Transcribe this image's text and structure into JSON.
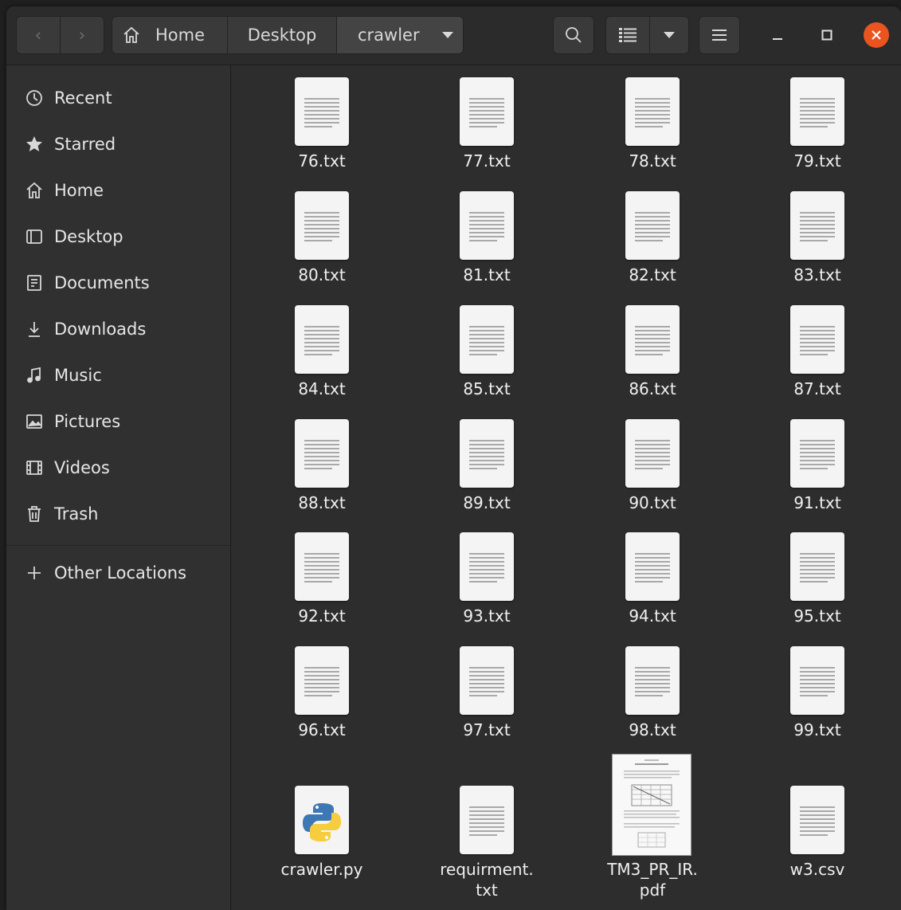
{
  "breadcrumb": {
    "items": [
      {
        "label": "Home"
      },
      {
        "label": "Desktop"
      },
      {
        "label": "crawler"
      }
    ]
  },
  "sidebar": {
    "items": [
      {
        "label": "Recent",
        "icon": "clock-icon"
      },
      {
        "label": "Starred",
        "icon": "star-icon"
      },
      {
        "label": "Home",
        "icon": "home-icon"
      },
      {
        "label": "Desktop",
        "icon": "desktop-icon"
      },
      {
        "label": "Documents",
        "icon": "document-icon"
      },
      {
        "label": "Downloads",
        "icon": "download-icon"
      },
      {
        "label": "Music",
        "icon": "music-icon"
      },
      {
        "label": "Pictures",
        "icon": "picture-icon"
      },
      {
        "label": "Videos",
        "icon": "film-icon"
      },
      {
        "label": "Trash",
        "icon": "trash-icon"
      }
    ],
    "other_locations": {
      "label": "Other Locations",
      "icon": "plus-icon"
    }
  },
  "files": [
    {
      "name": "76.txt",
      "type": "text"
    },
    {
      "name": "77.txt",
      "type": "text"
    },
    {
      "name": "78.txt",
      "type": "text"
    },
    {
      "name": "79.txt",
      "type": "text"
    },
    {
      "name": "80.txt",
      "type": "text"
    },
    {
      "name": "81.txt",
      "type": "text"
    },
    {
      "name": "82.txt",
      "type": "text"
    },
    {
      "name": "83.txt",
      "type": "text"
    },
    {
      "name": "84.txt",
      "type": "text"
    },
    {
      "name": "85.txt",
      "type": "text"
    },
    {
      "name": "86.txt",
      "type": "text"
    },
    {
      "name": "87.txt",
      "type": "text"
    },
    {
      "name": "88.txt",
      "type": "text"
    },
    {
      "name": "89.txt",
      "type": "text"
    },
    {
      "name": "90.txt",
      "type": "text"
    },
    {
      "name": "91.txt",
      "type": "text"
    },
    {
      "name": "92.txt",
      "type": "text"
    },
    {
      "name": "93.txt",
      "type": "text"
    },
    {
      "name": "94.txt",
      "type": "text"
    },
    {
      "name": "95.txt",
      "type": "text"
    },
    {
      "name": "96.txt",
      "type": "text"
    },
    {
      "name": "97.txt",
      "type": "text"
    },
    {
      "name": "98.txt",
      "type": "text"
    },
    {
      "name": "99.txt",
      "type": "text"
    },
    {
      "name": "crawler.py",
      "type": "python"
    },
    {
      "name": "requirment.\ntxt",
      "type": "text"
    },
    {
      "name": "TM3_PR_IR.\npdf",
      "type": "pdf"
    },
    {
      "name": "w3.csv",
      "type": "text"
    }
  ],
  "colors": {
    "accent_close": "#e95420",
    "window_bg": "#2d2d2d",
    "sidebar_bg": "#303030"
  }
}
